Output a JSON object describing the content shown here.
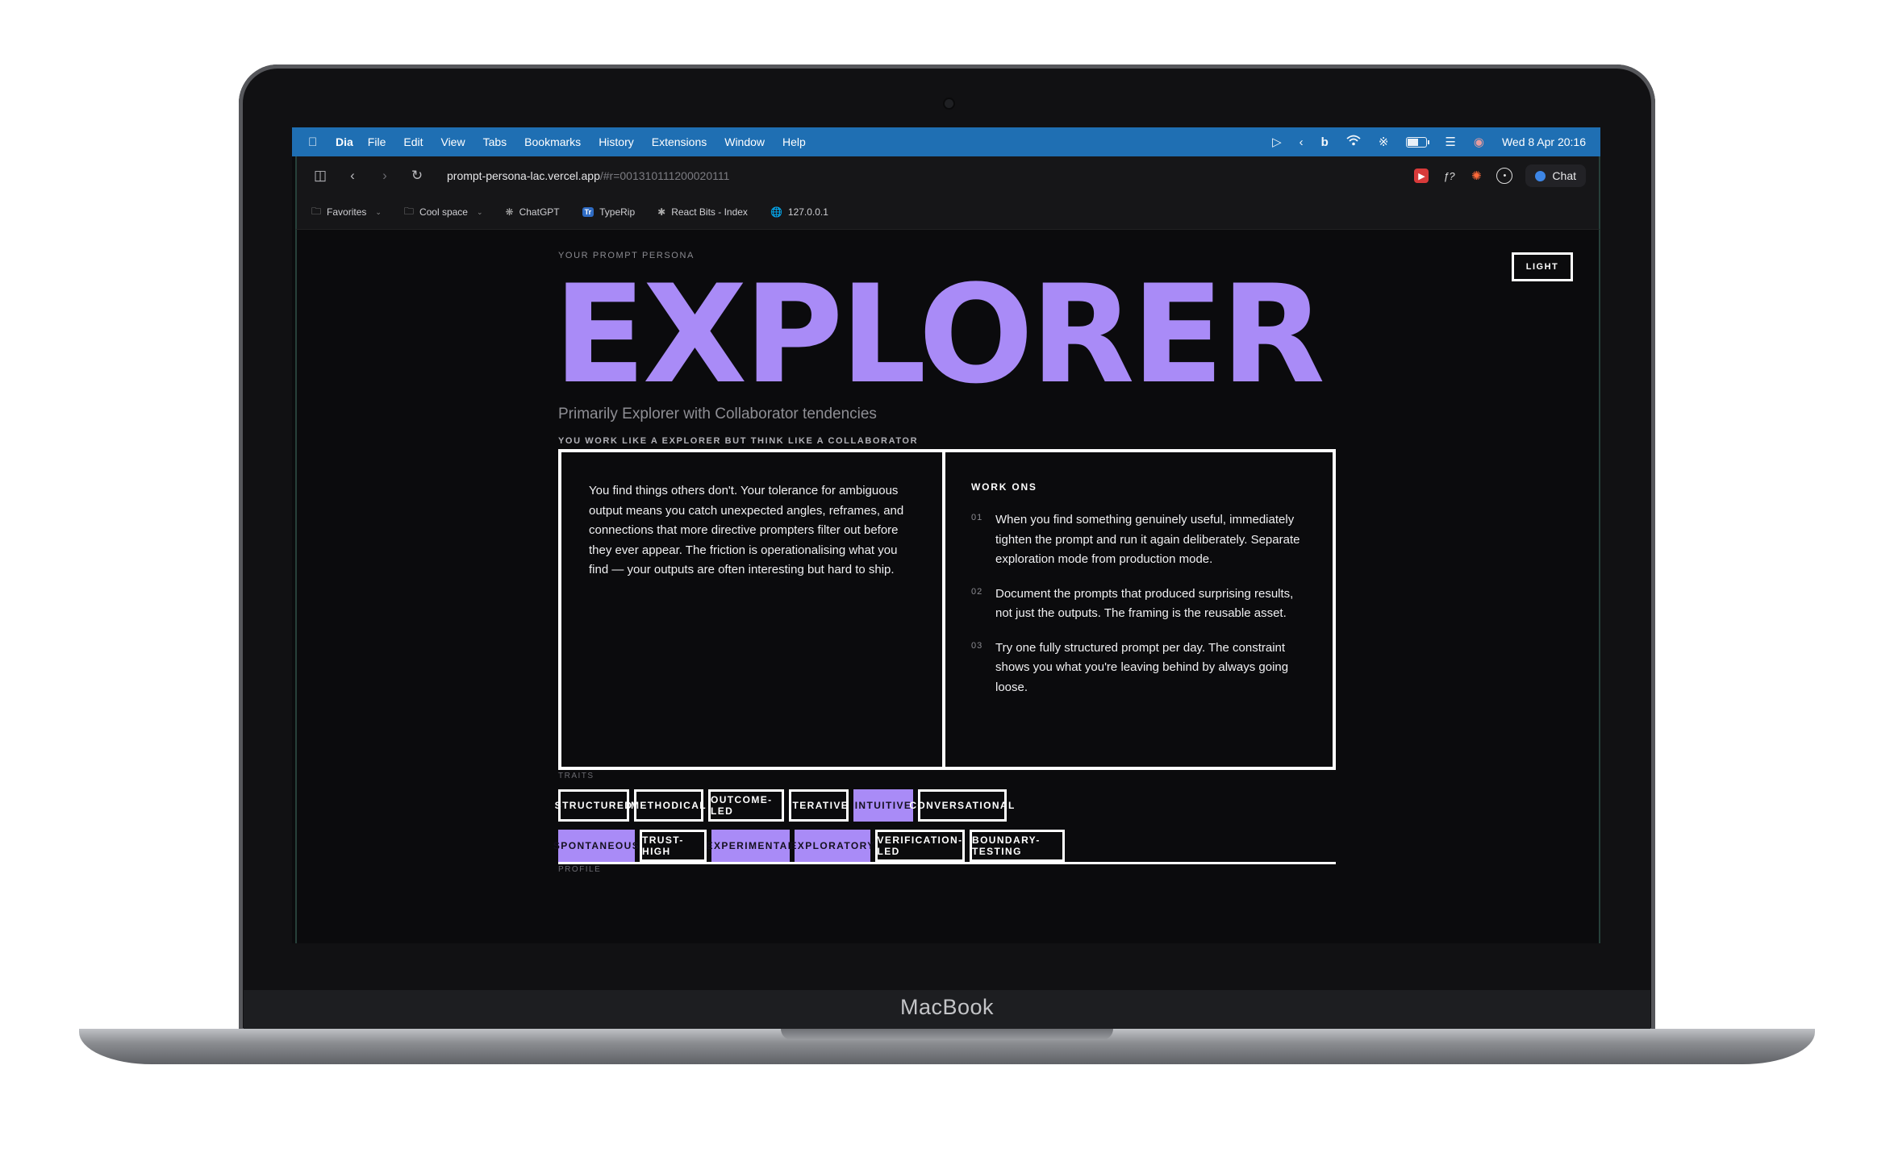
{
  "hardware": {
    "brand_label": "MacBook"
  },
  "menubar": {
    "app_name": "Dia",
    "items": [
      "File",
      "Edit",
      "View",
      "Tabs",
      "Bookmarks",
      "History",
      "Extensions",
      "Window",
      "Help"
    ],
    "datetime": "Wed 8 Apr  20:16",
    "battery_level": 0.6
  },
  "browser": {
    "url_host": "prompt-persona-lac.vercel.app",
    "url_rest": "/#r=00131011120002011​1",
    "chat_label": "Chat",
    "bookmarks": [
      {
        "label": "Favorites",
        "icon": "folder-icon",
        "dropdown": true
      },
      {
        "label": "Cool space",
        "icon": "folder-icon",
        "dropdown": true
      },
      {
        "label": "ChatGPT",
        "icon": "chatgpt-icon",
        "dropdown": false
      },
      {
        "label": "TypeRip",
        "icon": "typerip-icon",
        "dropdown": false
      },
      {
        "label": "React Bits - Index",
        "icon": "react-bits-icon",
        "dropdown": false
      },
      {
        "label": "127.0.0.1",
        "icon": "globe-icon",
        "dropdown": false
      }
    ]
  },
  "page": {
    "eyebrow": "YOUR PROMPT PERSONA",
    "theme_toggle": "LIGHT",
    "title": "EXPLORER",
    "subtitle": "Primarily Explorer with Collaborator tendencies",
    "tagline": "YOU WORK LIKE A EXPLORER BUT THINK LIKE A COLLABORATOR",
    "description": "You find things others don't. Your tolerance for ambiguous output means you catch unexpected angles, reframes, and connections that more directive prompters filter out before they ever appear. The friction is operationalising what you find — your outputs are often interesting but hard to ship.",
    "work_ons": {
      "heading": "WORK ONS",
      "items": [
        {
          "num": "01",
          "text": "When you find something genuinely useful, immediately tighten the prompt and run it again deliberately. Separate exploration mode from production mode."
        },
        {
          "num": "02",
          "text": "Document the prompts that produced surprising results, not just the outputs. The framing is the reusable asset."
        },
        {
          "num": "03",
          "text": "Try one fully structured prompt per day. The constraint shows you what you're leaving behind by always going loose."
        }
      ]
    },
    "traits_label": "TRAITS",
    "traits": [
      {
        "label": "STRUCTURED",
        "active": false
      },
      {
        "label": "METHODICAL",
        "active": false
      },
      {
        "label": "OUTCOME-LED",
        "active": false
      },
      {
        "label": "ITERATIVE",
        "active": false
      },
      {
        "label": "INTUITIVE",
        "active": true
      },
      {
        "label": "CONVERSATIONAL",
        "active": false
      },
      {
        "label": "SPONTANEOUS",
        "active": true
      },
      {
        "label": "TRUST-HIGH",
        "active": false
      },
      {
        "label": "EXPERIMENTAL",
        "active": true
      },
      {
        "label": "EXPLORATORY",
        "active": true
      },
      {
        "label": "VERIFICATION-LED",
        "active": false
      },
      {
        "label": "BOUNDARY-TESTING",
        "active": false
      }
    ],
    "profile_label": "PROFILE"
  },
  "colors": {
    "accent": "#a98bf7",
    "background": "#0b0b0d",
    "menubar": "#1f6fb3"
  }
}
